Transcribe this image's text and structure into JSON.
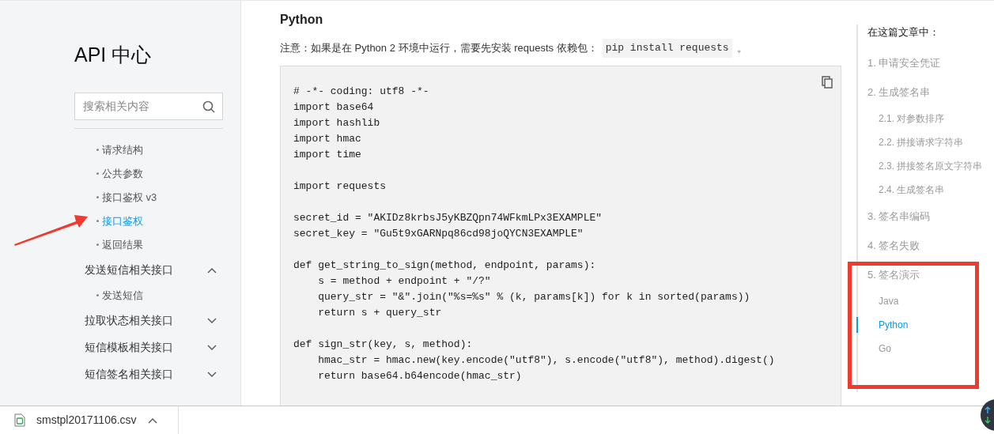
{
  "sidebar": {
    "title": "API 中心",
    "search": {
      "placeholder": "搜索相关内容"
    },
    "nav": [
      {
        "kind": "sub",
        "label": "请求结构",
        "selected": false
      },
      {
        "kind": "sub",
        "label": "公共参数",
        "selected": false
      },
      {
        "kind": "sub",
        "label": "接口鉴权 v3",
        "selected": false
      },
      {
        "kind": "sub",
        "label": "接口鉴权",
        "selected": true
      },
      {
        "kind": "sub",
        "label": "返回结果",
        "selected": false
      },
      {
        "kind": "group",
        "label": "发送短信相关接口",
        "expanded": true
      },
      {
        "kind": "sub",
        "label": "发送短信",
        "selected": false
      },
      {
        "kind": "group",
        "label": "拉取状态相关接口",
        "expanded": false
      },
      {
        "kind": "group",
        "label": "短信模板相关接口",
        "expanded": false
      },
      {
        "kind": "group",
        "label": "短信签名相关接口",
        "expanded": false
      }
    ]
  },
  "article": {
    "heading": "Python",
    "note": {
      "text": "注意：如果是在 Python 2 环境中运行，需要先安装 requests 依赖包：",
      "code": "pip install requests",
      "end": "。"
    },
    "code_blocks": [
      [
        "# -*- coding: utf8 -*-",
        "import base64",
        "import hashlib",
        "import hmac",
        "import time"
      ],
      [
        "import requests"
      ],
      [
        "secret_id = \"AKIDz8krbsJ5yKBZQpn74WFkmLPx3EXAMPLE\"",
        "secret_key = \"Gu5t9xGARNpq86cd98joQYCN3EXAMPLE\""
      ],
      [
        "def get_string_to_sign(method, endpoint, params):",
        "    s = method + endpoint + \"/?\"",
        "    query_str = \"&\".join(\"%s=%s\" % (k, params[k]) for k in sorted(params))",
        "    return s + query_str"
      ],
      [
        "def sign_str(key, s, method):",
        "    hmac_str = hmac.new(key.encode(\"utf8\"), s.encode(\"utf8\"), method).digest()",
        "    return base64.b64encode(hmac_str)"
      ]
    ]
  },
  "toc": {
    "title": "在这篇文章中：",
    "items": [
      {
        "label": "1. 申请安全凭证",
        "selected": false
      },
      {
        "label": "2. 生成签名串",
        "selected": false,
        "children": [
          {
            "label": "2.1. 对参数排序",
            "selected": false
          },
          {
            "label": "2.2. 拼接请求字符串",
            "selected": false
          },
          {
            "label": "2.3. 拼接签名原文字符串",
            "selected": false
          },
          {
            "label": "2.4. 生成签名串",
            "selected": false
          }
        ]
      },
      {
        "label": "3. 签名串编码",
        "selected": false
      },
      {
        "label": "4. 签名失败",
        "selected": false
      },
      {
        "label": "5. 签名演示",
        "selected": false,
        "children": [
          {
            "label": "Java",
            "selected": false
          },
          {
            "label": "Python",
            "selected": true
          },
          {
            "label": "Go",
            "selected": false
          }
        ]
      }
    ]
  },
  "download_bar": {
    "file_name": "smstpl20171106.csv"
  }
}
